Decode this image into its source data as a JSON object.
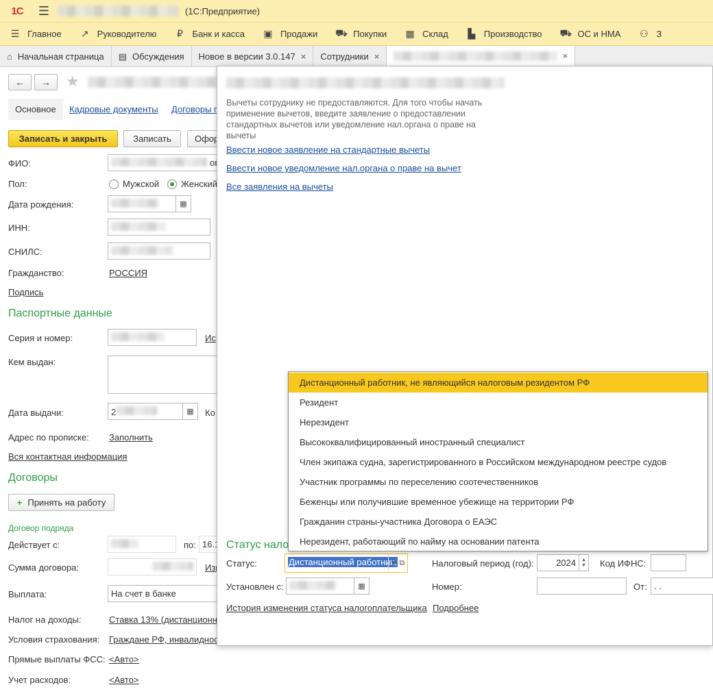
{
  "titlebar": {
    "logo": "1С",
    "app_name": "(1С:Предприятие)"
  },
  "menu": [
    {
      "icon": "hamburger-icon",
      "glyph": "☰",
      "label": "Главное"
    },
    {
      "icon": "chart-trend-icon",
      "glyph": "↗",
      "label": "Руководителю"
    },
    {
      "icon": "ruble-coin-icon",
      "glyph": "₽",
      "label": "Банк и касса"
    },
    {
      "icon": "shopping-bag-icon",
      "glyph": "▣",
      "label": "Продажи"
    },
    {
      "icon": "cart-icon",
      "glyph": "⛟",
      "label": "Покупки"
    },
    {
      "icon": "warehouse-icon",
      "glyph": "▦",
      "label": "Склад"
    },
    {
      "icon": "factory-icon",
      "glyph": "▙",
      "label": "Производство"
    },
    {
      "icon": "truck-icon",
      "glyph": "⛟",
      "label": "ОС и НМА"
    },
    {
      "icon": "person-icon",
      "glyph": "⚇",
      "label": "З"
    }
  ],
  "tabs": [
    {
      "icon": "home-icon",
      "glyph": "⌂",
      "label": "Начальная страница",
      "close": ""
    },
    {
      "icon": "discussion-icon",
      "glyph": "▤",
      "label": "Обсуждения",
      "close": ""
    },
    {
      "icon": "",
      "glyph": "",
      "label": "Новое в версии 3.0.147",
      "close": "×"
    },
    {
      "icon": "",
      "glyph": "",
      "label": "Сотрудники",
      "close": "×"
    }
  ],
  "active_tab_close": "×",
  "nav": {
    "back": "←",
    "forward": "→",
    "star": "★"
  },
  "subtabs": {
    "main": "Основное",
    "hr_docs": "Кадровые документы",
    "contracts": "Договоры п"
  },
  "buttons": {
    "save_close": "Записать и закрыть",
    "save": "Записать",
    "more": "Офор"
  },
  "form": {
    "fio_label": "ФИО:",
    "fio_suffix": "ов",
    "gender_label": "Пол:",
    "male": "Мужской",
    "female": "Женский",
    "birth_label": "Дата рождения:",
    "birth_value": "",
    "inn_label": "ИНН:",
    "inn_value": "",
    "snils_label": "СНИЛС:",
    "citizenship_label": "Гражданство:",
    "citizenship_value": "РОССИЯ",
    "signature_link": "Подпись"
  },
  "passport": {
    "title": "Паспортные данные",
    "series_label": "Серия и номер:",
    "series_hint": "Ис",
    "issued_by_label": "Кем выдан:",
    "issue_date_label": "Дата выдачи:",
    "issue_date_value": "2",
    "code_label": "Ко",
    "address_label": "Адрес по прописке:",
    "address_link": "Заполнить",
    "contacts_link": "Вся контактная информация"
  },
  "contracts": {
    "title": "Договоры",
    "hire_button": "Принять на работу",
    "hire_plus": "+",
    "contract_title": "Договор подряда",
    "valid_label": "Действует с:",
    "to_label": "по:",
    "to_value": "16.1",
    "amount_label": "Сумма договора:",
    "amount_value": "",
    "amount_link": "Изм",
    "payout_label": "Выплата:",
    "payout_value": "На счет в банке",
    "tax_label": "Налог на доходы:",
    "tax_link": "Ставка 13% (дистанционн",
    "insurance_label": "Условия страхования:",
    "insurance_link": "Граждане РФ, инвалидност",
    "fss_label": "Прямые выплаты ФСС:",
    "fss_link": "<Авто>",
    "expense_label": "Учет расходов:",
    "expense_link": "<Авто>"
  },
  "popup": {
    "hint": "Вычеты сотруднику не предоставляются. Для того чтобы начать применение вычетов, введите заявление о предоставлении стандартных вычетов или уведомление нал.органа о праве на вычеты",
    "link1": "Ввести новое заявление на стандартные вычеты",
    "link2": "Ввести новое уведомление нал.органа о праве на вычет",
    "link3": "Все заявления на вычеты",
    "status_title": "Статус нало",
    "status_label": "Статус:",
    "status_value": "Дистанционный работник,",
    "period_label": "Налоговый период (год):",
    "period_value": "2024",
    "ifns_label": "Код ИФНС:",
    "established_label": "Установлен с:",
    "number_label": "Номер:",
    "from_label": "От:",
    "from_value": " .  .",
    "history_link": "История изменения статуса налогоплательщика",
    "more_link": "Подробнее"
  },
  "dropdown": [
    "Дистанционный работник, не являющийся налоговым резидентом РФ",
    "Резидент",
    "Нерезидент",
    "Высококвалифицированный иностранный специалист",
    "Член экипажа судна, зарегистрированного в Российском международном реестре судов",
    "Участник программы по переселению соотечественников",
    "Беженцы или получившие временное убежище на территории РФ",
    "Гражданин страны-участника Договора о ЕАЭС",
    "Нерезидент, работающий по найму на основании патента"
  ],
  "dropdown_selected": 0,
  "colors": {
    "accent_yellow": "#f8c81e",
    "section_green": "#2e9e44",
    "link_blue": "#1a4f9c"
  }
}
